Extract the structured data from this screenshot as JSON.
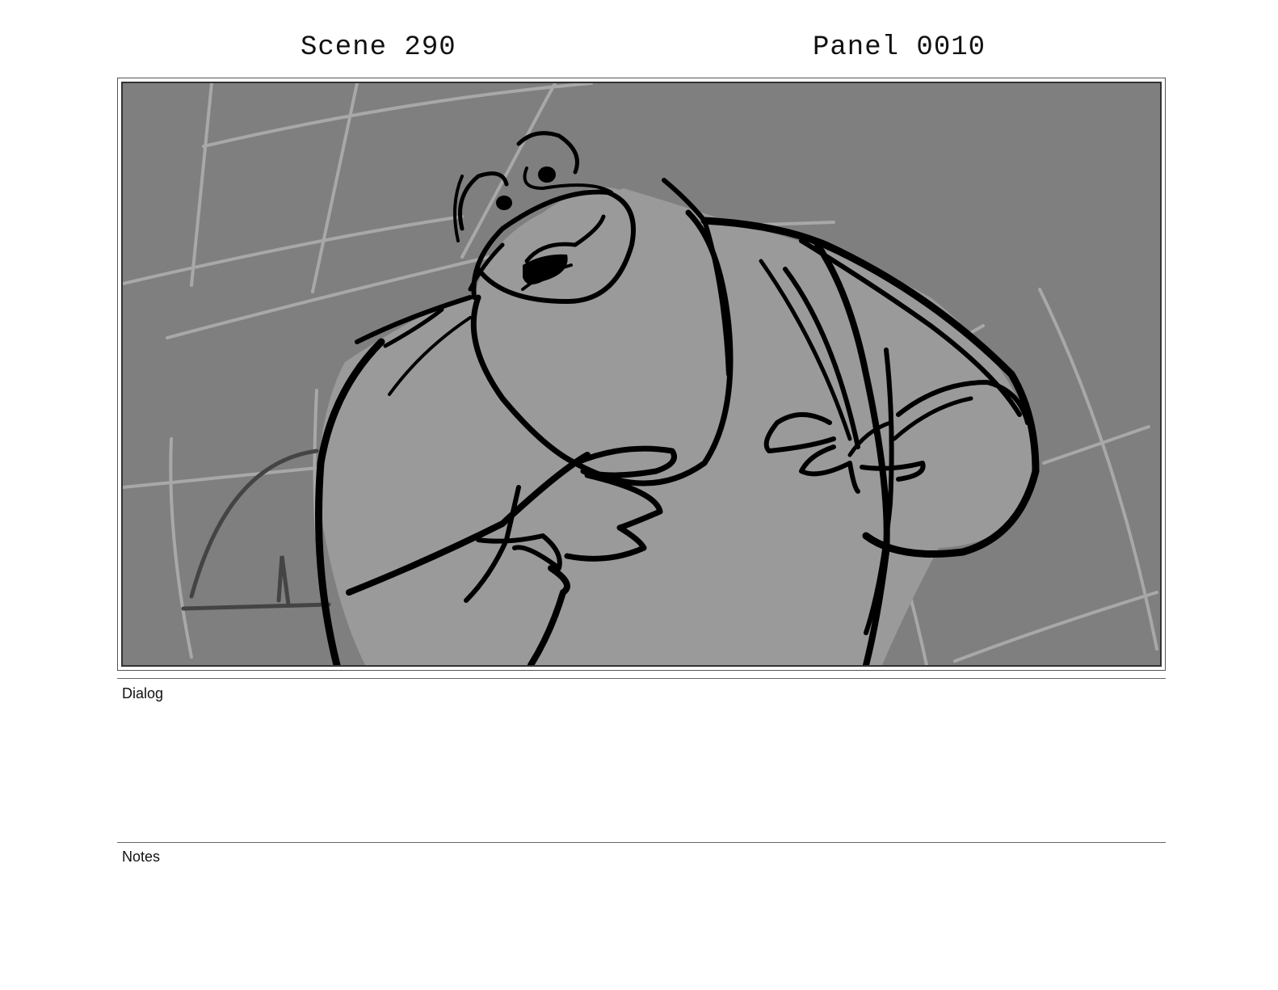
{
  "header": {
    "scene_label": "Scene 290",
    "panel_label": "Panel 0010"
  },
  "panel_image": {
    "icon": "storyboard-sketch",
    "description_colors": {
      "background": "#7f7f7f",
      "figure_fill": "#9a9a9a",
      "grid_lines": "#a8a8a8",
      "ink": "#000000"
    }
  },
  "sections": {
    "dialog_label": "Dialog",
    "notes_label": "Notes"
  }
}
